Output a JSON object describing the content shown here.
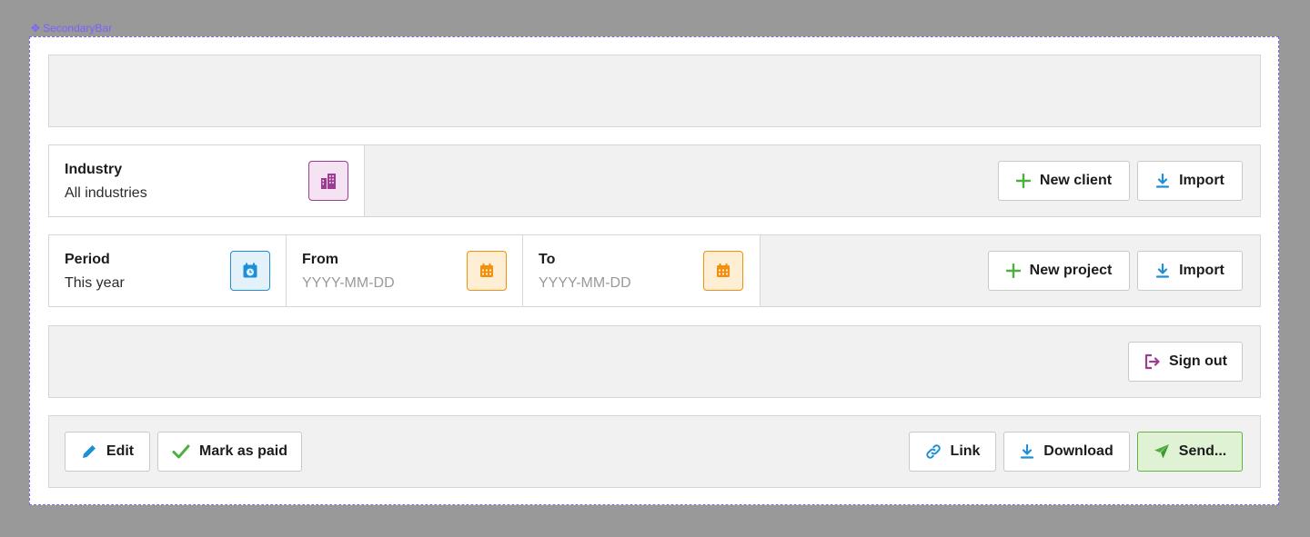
{
  "frame": {
    "label": "SecondaryBar",
    "label_icon": "component-icon"
  },
  "row2": {
    "industry": {
      "label": "Industry",
      "value": "All industries",
      "icon": "building-icon",
      "icon_color": "#9b3d93"
    },
    "buttons": {
      "new_client": "New client",
      "import": "Import"
    }
  },
  "row3": {
    "period": {
      "label": "Period",
      "value": "This year",
      "icon": "calendar-clock-icon",
      "icon_color": "#1e8fd6"
    },
    "from": {
      "label": "From",
      "placeholder": "YYYY-MM-DD",
      "icon": "calendar-icon",
      "icon_color": "#f0900c"
    },
    "to": {
      "label": "To",
      "placeholder": "YYYY-MM-DD",
      "icon": "calendar-icon",
      "icon_color": "#f0900c"
    },
    "buttons": {
      "new_project": "New project",
      "import": "Import"
    }
  },
  "row4": {
    "buttons": {
      "sign_out": "Sign out"
    }
  },
  "row5": {
    "left_buttons": {
      "edit": "Edit",
      "mark_as_paid": "Mark as paid"
    },
    "right_buttons": {
      "link": "Link",
      "download": "Download",
      "send": "Send..."
    }
  },
  "colors": {
    "accent_green": "#4caf3e",
    "accent_blue": "#1e8fd6",
    "accent_purple": "#9b3d93",
    "accent_orange": "#f0900c"
  }
}
